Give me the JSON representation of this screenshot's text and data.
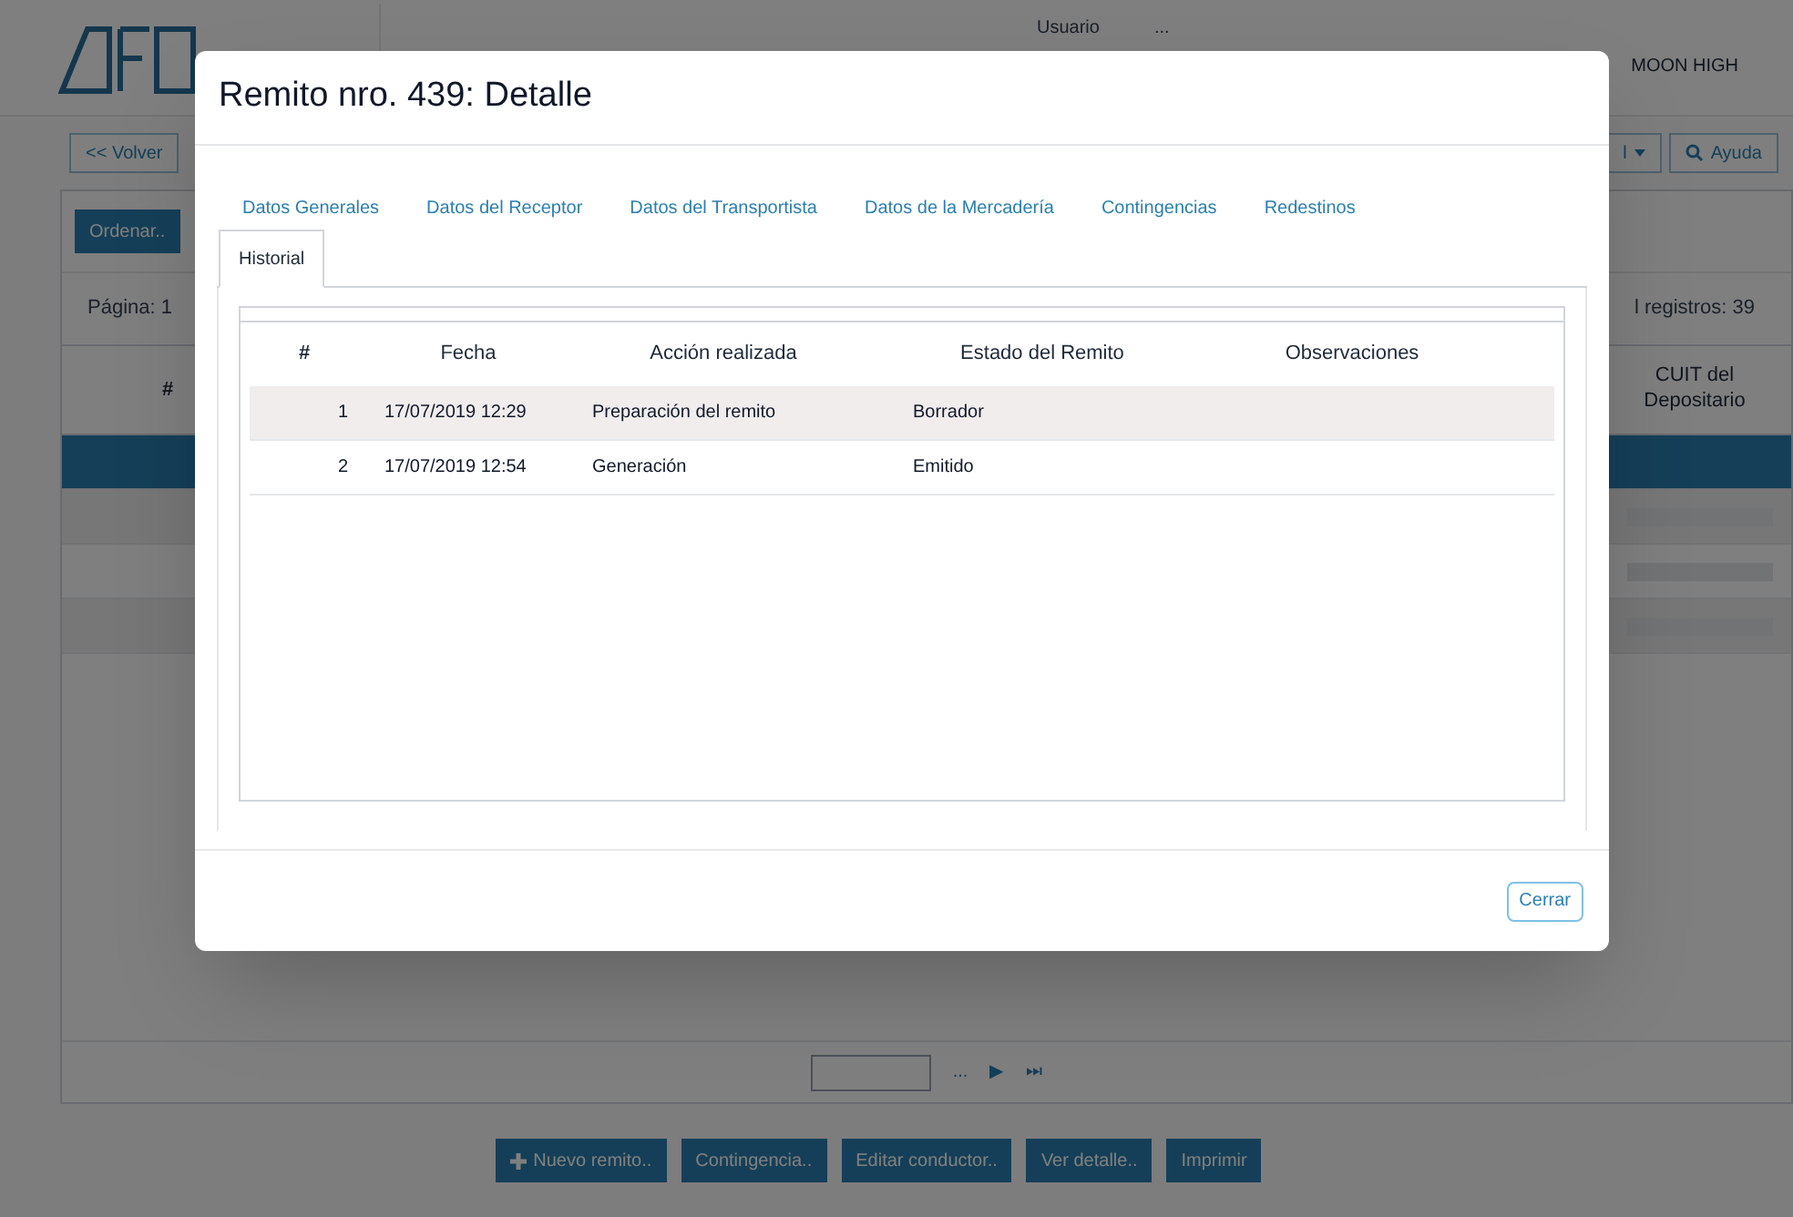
{
  "background": {
    "header": {
      "user_label": "Usuario",
      "user_value": "...",
      "company": "MOON HIGH"
    },
    "toolbar": {
      "back_button": "<< Volver",
      "menu_fragment": "l",
      "help_button": "Ayuda"
    },
    "sort_button": "Ordenar..",
    "page_label": "Página: 1",
    "total_label": "l registros: 39",
    "table": {
      "columns": [
        "#",
        "CUIT del Depositario"
      ],
      "rows": [
        {
          "selected": true
        },
        {
          "selected": false
        },
        {
          "selected": false
        },
        {
          "selected": false
        }
      ]
    },
    "pager": {
      "ellipsis": "...",
      "next": "▶",
      "last": "⏭"
    },
    "buttons": [
      {
        "label": "Nuevo remito..",
        "kind": "add"
      },
      {
        "label": "Contingencia..",
        "kind": "plain"
      },
      {
        "label": "Editar conductor..",
        "kind": "plain"
      },
      {
        "label": "Ver detalle..",
        "kind": "plain"
      },
      {
        "label": "Imprimir",
        "kind": "plain"
      }
    ]
  },
  "dialog": {
    "title": "Remito nro. 439: Detalle",
    "tabs": [
      {
        "label": "Datos Generales",
        "selected": false
      },
      {
        "label": "Datos del Receptor",
        "selected": false
      },
      {
        "label": "Datos del Transportista",
        "selected": false
      },
      {
        "label": "Datos de la Mercadería",
        "selected": false
      },
      {
        "label": "Contingencias",
        "selected": false
      },
      {
        "label": "Redestinos",
        "selected": false
      },
      {
        "label": "Historial",
        "selected": true
      }
    ],
    "table": {
      "columns": [
        "#",
        "Fecha",
        "Acción realizada",
        "Estado del Remito",
        "Observaciones"
      ],
      "rows": [
        {
          "cells": [
            "1",
            "17/07/2019 12:29",
            "Preparación del remito",
            "Borrador",
            ""
          ],
          "selected": true
        },
        {
          "cells": [
            "2",
            "17/07/2019 12:54",
            "Generación",
            "Emitido",
            ""
          ],
          "selected": false
        }
      ]
    },
    "close_button": "Cerrar"
  }
}
